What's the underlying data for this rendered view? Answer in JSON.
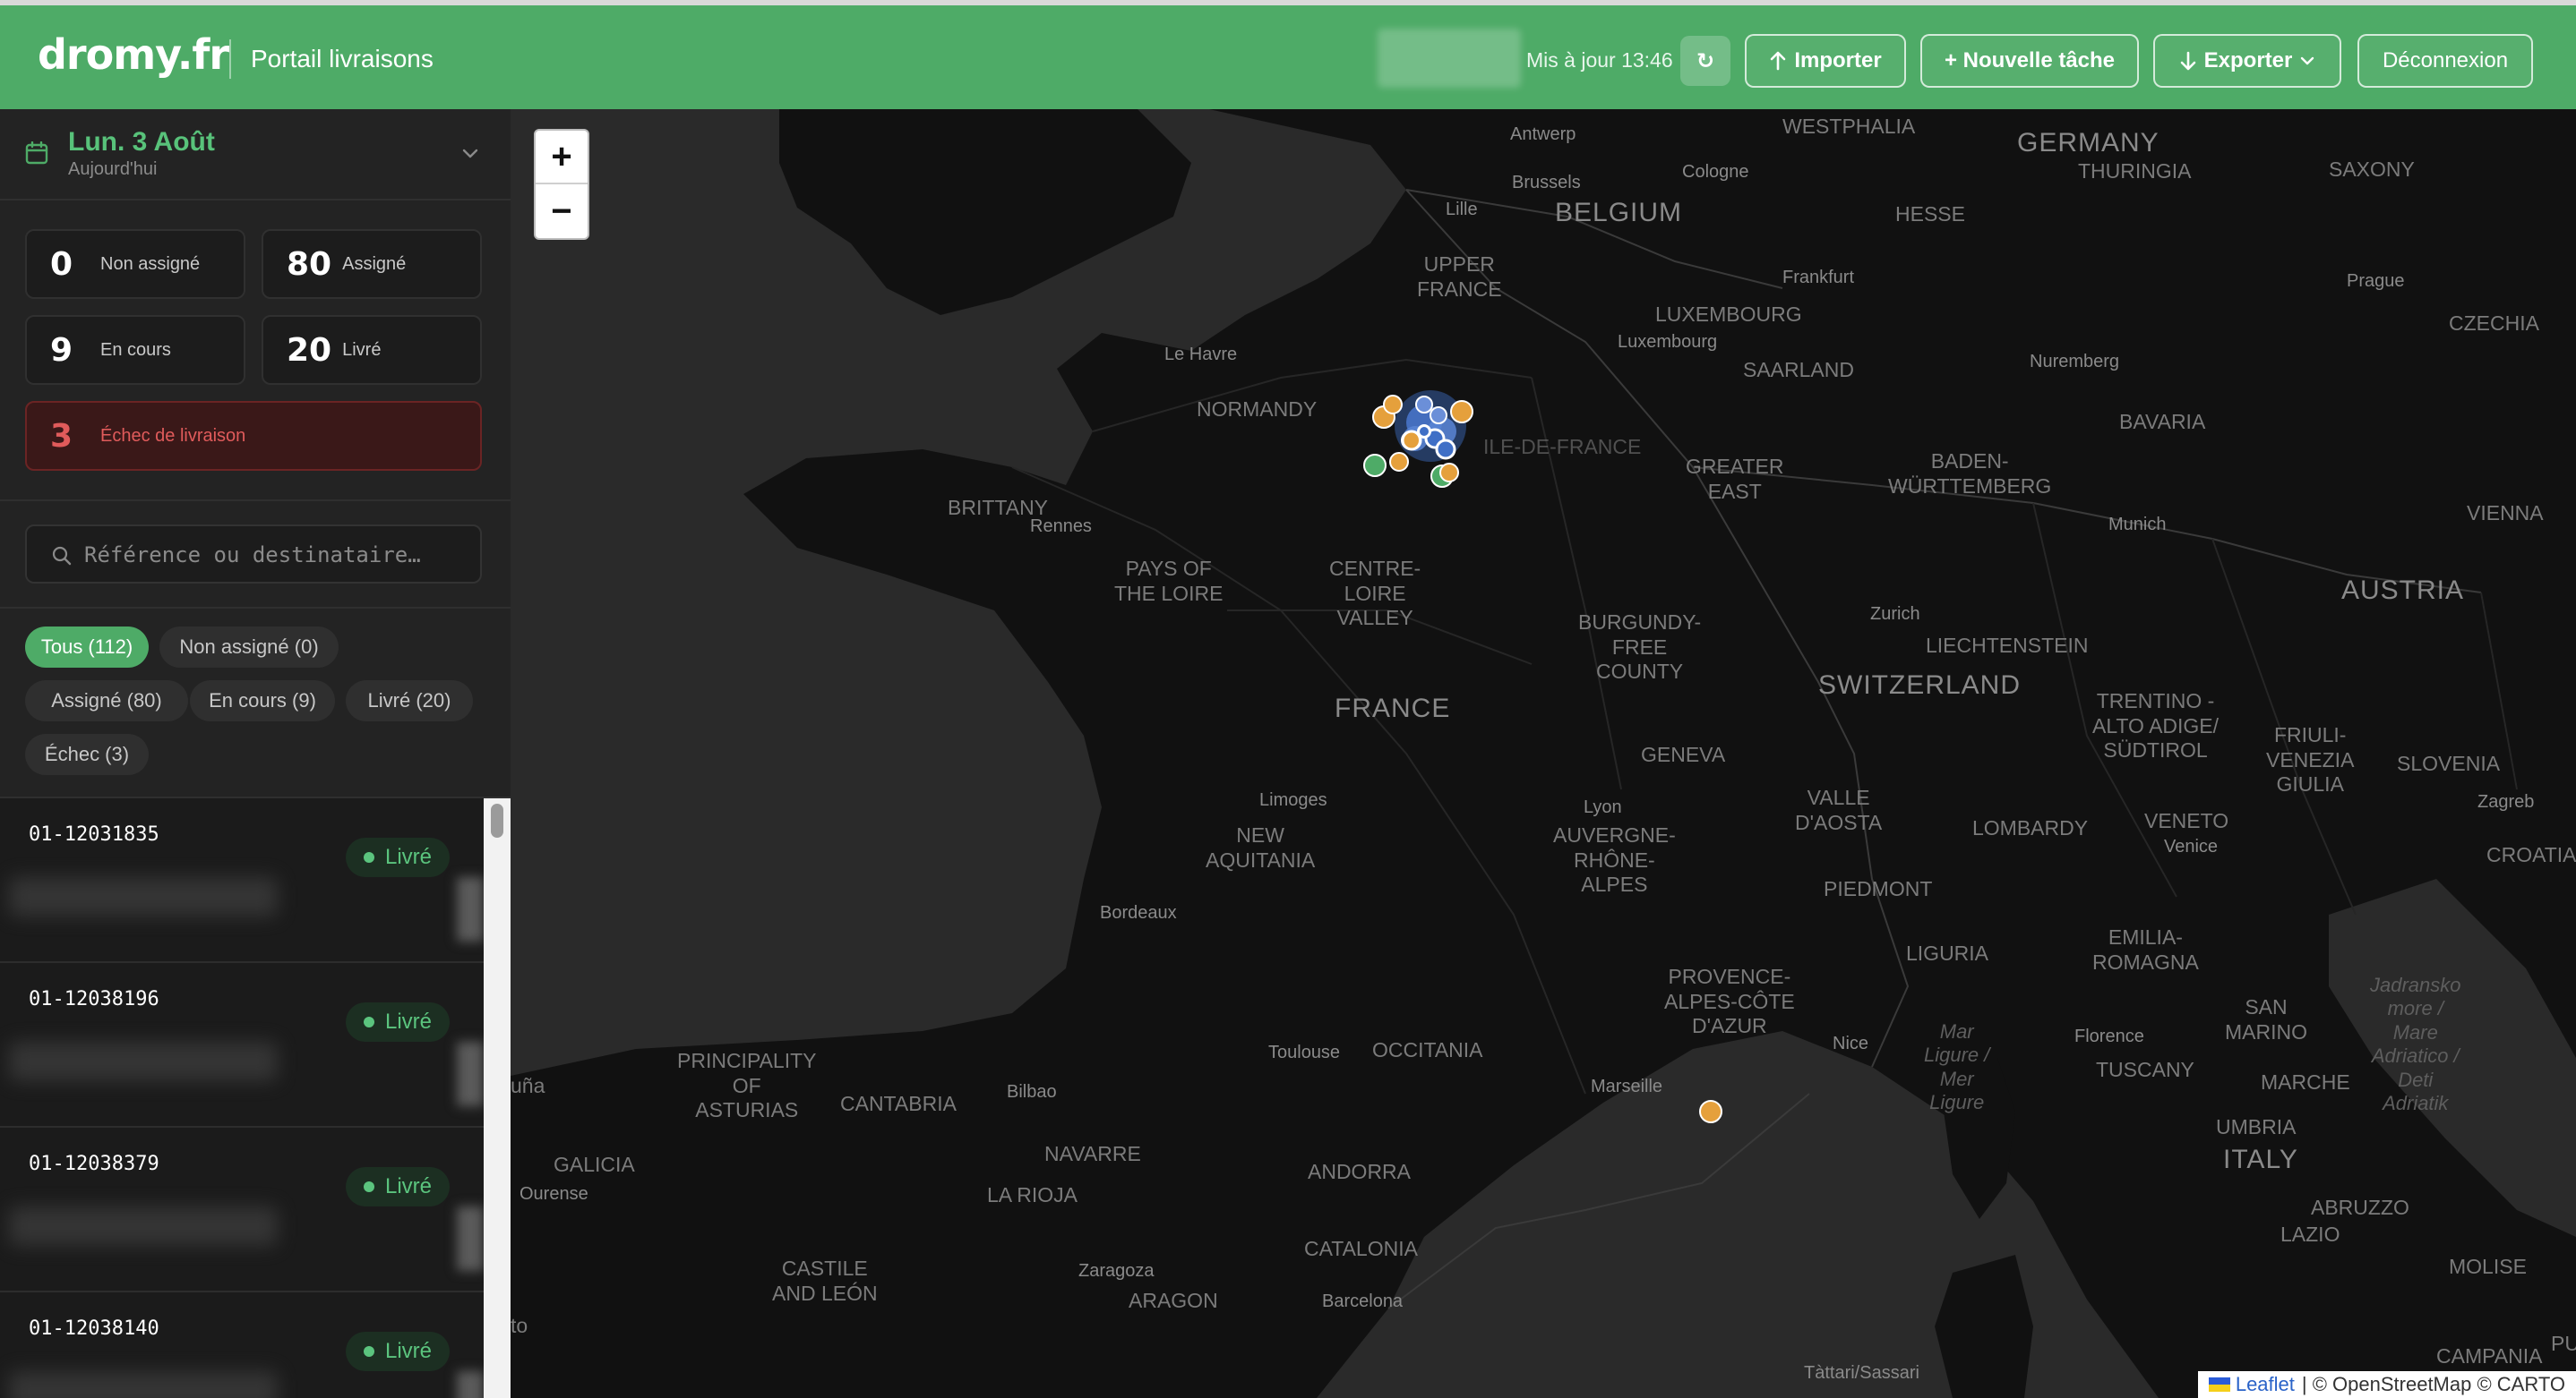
{
  "app": {
    "logo": "dromy.fr",
    "title": "Portail livraisons",
    "updated": "Mis à jour 13:46",
    "refresh_icon": "↻",
    "buttons": {
      "import": "Importer",
      "new_task": "+ Nouvelle tâche",
      "export": "Exporter",
      "logout": "Déconnexion"
    }
  },
  "sidebar": {
    "date": {
      "main": "Lun. 3 Août",
      "sub": "Aujourd'hui"
    },
    "stats": [
      {
        "value": "0",
        "label": "Non assigné"
      },
      {
        "value": "80",
        "label": "Assigné"
      },
      {
        "value": "9",
        "label": "En cours"
      },
      {
        "value": "20",
        "label": "Livré"
      },
      {
        "value": "3",
        "label": "Échec de livraison"
      }
    ],
    "search": {
      "placeholder": "Référence ou destinataire…"
    },
    "filters": [
      {
        "label": "Tous (112)",
        "active": true
      },
      {
        "label": "Non assigné (0)"
      },
      {
        "label": "Assigné (80)"
      },
      {
        "label": "En cours (9)"
      },
      {
        "label": "Livré (20)"
      },
      {
        "label": "Échec (3)"
      }
    ],
    "deliveries": [
      {
        "ref": "01-12031835",
        "status": "Livré"
      },
      {
        "ref": "01-12038196",
        "status": "Livré"
      },
      {
        "ref": "01-12038379",
        "status": "Livré"
      },
      {
        "ref": "01-12038140",
        "status": "Livré"
      }
    ]
  },
  "map": {
    "zoom_in": "+",
    "zoom_out": "−",
    "attribution": {
      "leaflet": "Leaflet",
      "rest": "| © OpenStreetMap © CARTO"
    },
    "labels": [
      {
        "t": "WESTPHALIA"
      },
      {
        "t": "GERMANY"
      },
      {
        "t": "THURINGIA"
      },
      {
        "t": "SAXONY"
      },
      {
        "t": "Antwerp"
      },
      {
        "t": "Cologne"
      },
      {
        "t": "Brussels"
      },
      {
        "t": "BELGIUM"
      },
      {
        "t": "HESSE"
      },
      {
        "t": "Lille"
      },
      {
        "t": "Prague"
      },
      {
        "t": "UPPER\nFRANCE"
      },
      {
        "t": "Frankfurt"
      },
      {
        "t": "CZECHIA"
      },
      {
        "t": "LUXEMBOURG"
      },
      {
        "t": "Luxembourg"
      },
      {
        "t": "Nuremberg"
      },
      {
        "t": "Le Havre"
      },
      {
        "t": "SAARLAND"
      },
      {
        "t": "NORMANDY"
      },
      {
        "t": "ILE-DE-FRANCE"
      },
      {
        "t": "BAVARIA"
      },
      {
        "t": "GREATER\nEAST"
      },
      {
        "t": "BADEN-\nWÜRTTEMBERG"
      },
      {
        "t": "BRITTANY"
      },
      {
        "t": "Rennes"
      },
      {
        "t": "Munich"
      },
      {
        "t": "VIENNA"
      },
      {
        "t": "PAYS OF\nTHE LOIRE"
      },
      {
        "t": "CENTRE-\nLOIRE\nVALLEY"
      },
      {
        "t": "AUSTRIA"
      },
      {
        "t": "Zurich"
      },
      {
        "t": "BURGUNDY-\nFREE\nCOUNTY"
      },
      {
        "t": "LIECHTENSTEIN"
      },
      {
        "t": "SWITZERLAND"
      },
      {
        "t": "TRENTINO -\nALTO ADIGE/\nSÜDTIROL"
      },
      {
        "t": "FRIULI-\nVENEZIA\nGIULIA"
      },
      {
        "t": "SLOVENIA"
      },
      {
        "t": "FRANCE"
      },
      {
        "t": "GENEVA"
      },
      {
        "t": "Zagreb"
      },
      {
        "t": "Limoges"
      },
      {
        "t": "Lyon"
      },
      {
        "t": "VALLE\nD'AOSTA"
      },
      {
        "t": "VENETO"
      },
      {
        "t": "Venice"
      },
      {
        "t": "CROATIA"
      },
      {
        "t": "NEW\nAQUITANIA"
      },
      {
        "t": "AUVERGNE-\nRHÔNE-\nALPES"
      },
      {
        "t": "LOMBARDY"
      },
      {
        "t": "Bordeaux"
      },
      {
        "t": "PIEDMONT"
      },
      {
        "t": "EMILIA-\nROMAGNA"
      },
      {
        "t": "LIGURIA"
      },
      {
        "t": "PROVENCE-\nALPES-CÔTE\nD'AZUR"
      },
      {
        "t": "SAN\nMARINO"
      },
      {
        "t": "Jadransko\nmore /\nMare\nAdriatico /\nDeti\nAdriatik"
      },
      {
        "t": "Mar\nLigure /\nMer\nLigure"
      },
      {
        "t": "Florence"
      },
      {
        "t": "Nice"
      },
      {
        "t": "PRINCIPALITY\nOF\nASTURIAS"
      },
      {
        "t": "TUSCANY"
      },
      {
        "t": "MARCHE"
      },
      {
        "t": "Toulouse"
      },
      {
        "t": "OCCITANIA"
      },
      {
        "t": "Marseille"
      },
      {
        "t": "UMBRIA"
      },
      {
        "t": "CANTABRIA"
      },
      {
        "t": "Bilbao"
      },
      {
        "t": "ITALY"
      },
      {
        "t": "NAVARRE"
      },
      {
        "t": "ANDORRA"
      },
      {
        "t": "ABRUZZO"
      },
      {
        "t": "GALICIA"
      },
      {
        "t": "Ourense"
      },
      {
        "t": "LA RIOJA"
      },
      {
        "t": "LAZIO"
      },
      {
        "t": "MOLISE"
      },
      {
        "t": "CATALONIA"
      },
      {
        "t": "CASTILE\nAND LEÓN"
      },
      {
        "t": "Zaragoza"
      },
      {
        "t": "ARAGON"
      },
      {
        "t": "Barcelona"
      },
      {
        "t": "CAMPANIA"
      },
      {
        "t": "Tàttari/Sassari"
      },
      {
        "t": "PU"
      },
      {
        "t": "uña"
      },
      {
        "t": "to"
      }
    ]
  }
}
